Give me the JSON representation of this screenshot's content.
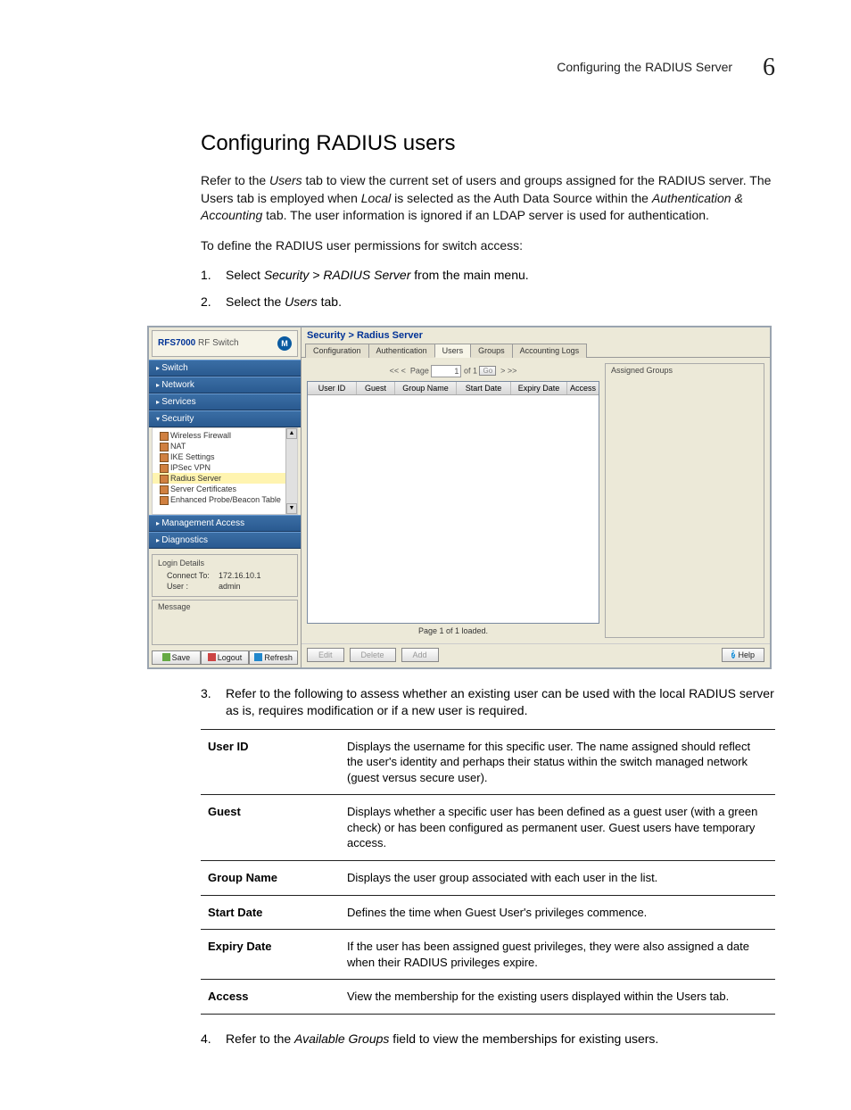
{
  "header": {
    "running_title": "Configuring the RADIUS Server",
    "chapter_number": "6"
  },
  "section": {
    "title": "Configuring RADIUS users",
    "intro_p1_pre": "Refer to the ",
    "intro_p1_em1": "Users",
    "intro_p1_mid1": " tab to view the current set of users and groups assigned for the RADIUS server. The Users tab is employed when ",
    "intro_p1_em2": "Local",
    "intro_p1_mid2": " is selected as the Auth Data Source within the ",
    "intro_p1_em3": "Authentication & Accounting",
    "intro_p1_post": " tab. The user information is ignored if an LDAP server is used for authentication.",
    "intro_p2": "To define the RADIUS user permissions for switch access:",
    "step1_pre": "Select ",
    "step1_em": "Security > RADIUS Server",
    "step1_post": " from the main menu.",
    "step2_pre": "Select the ",
    "step2_em": "Users",
    "step2_post": " tab.",
    "step3": "Refer to the following to assess whether an existing user can be used with the local RADIUS server as is, requires modification or if a new user is required.",
    "step4_pre": "Refer to the ",
    "step4_em": "Available Groups",
    "step4_post": " field to view the memberships for existing users."
  },
  "screenshot": {
    "brand_bold": "RFS7000",
    "brand_rest": " RF Switch",
    "nav": {
      "switch": "Switch",
      "network": "Network",
      "services": "Services",
      "security": "Security",
      "mgmt": "Management Access",
      "diag": "Diagnostics",
      "sub": {
        "wf": "Wireless Firewall",
        "nat": "NAT",
        "ike": "IKE Settings",
        "ipsec": "IPSec VPN",
        "radius": "Radius Server",
        "cert": "Server Certificates",
        "probe": "Enhanced Probe/Beacon Table"
      }
    },
    "login": {
      "title": "Login Details",
      "connect_l": "Connect To:",
      "connect_v": "172.16.10.1",
      "user_l": "User :",
      "user_v": "admin"
    },
    "msg_title": "Message",
    "buttons": {
      "save": "Save",
      "logout": "Logout",
      "refresh": "Refresh",
      "edit": "Edit",
      "delete": "Delete",
      "add": "Add",
      "help": "Help"
    },
    "crumb": "Security > Radius Server",
    "tabs": {
      "config": "Configuration",
      "auth": "Authentication",
      "users": "Users",
      "groups": "Groups",
      "acct": "Accounting Logs"
    },
    "pager": {
      "prev": "<< <",
      "page_label": "Page",
      "page_value": "1",
      "of": "of 1",
      "go": "Go",
      "next": "> >>"
    },
    "columns": {
      "user_id": "User ID",
      "guest": "Guest",
      "group": "Group Name",
      "start": "Start Date",
      "expiry": "Expiry Date",
      "access": "Access"
    },
    "footer": "Page 1 of 1 loaded.",
    "assigned": "Assigned Groups"
  },
  "def_table": [
    {
      "term": "User ID",
      "desc": "Displays the username for this specific user. The name assigned should reflect the user's identity and perhaps their status within the switch managed network (guest versus secure user)."
    },
    {
      "term": "Guest",
      "desc": "Displays whether a specific user has been defined as a guest user (with a green check) or has been configured as permanent user. Guest users have temporary access."
    },
    {
      "term": "Group Name",
      "desc": "Displays the user group associated with each user in the list."
    },
    {
      "term": "Start Date",
      "desc": "Defines the time when Guest User's privileges commence."
    },
    {
      "term": "Expiry Date",
      "desc": "If the user has been assigned guest privileges, they were also assigned a date when their RADIUS privileges expire."
    },
    {
      "term": "Access",
      "desc": "View the membership for the existing users displayed within the Users tab."
    }
  ]
}
